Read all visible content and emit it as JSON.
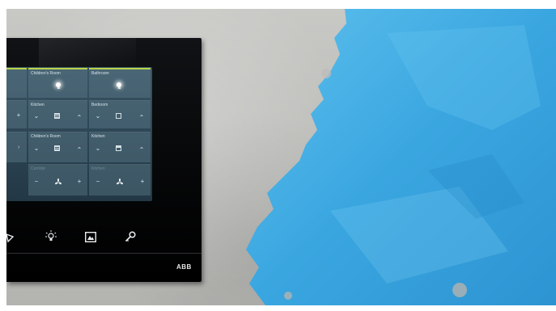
{
  "scene": {
    "colors": {
      "paint_blue": "#3aa6e0",
      "paint_blue_light": "#63c3ef",
      "wall_gray": "#bdbdba",
      "device_black": "#050607",
      "screen_teal": "#2c4453",
      "accent_green": "#b9d44a"
    }
  },
  "device": {
    "brand": "ABB",
    "tiles": [
      {
        "label": "Children's Room",
        "kind": "light",
        "active": true
      },
      {
        "label": "Bathroom",
        "kind": "light",
        "active": true
      },
      {
        "label": "Kitchen",
        "kind": "blind",
        "active": false
      },
      {
        "label": "Bedroom",
        "kind": "blind",
        "active": false
      },
      {
        "label": "Children's Room",
        "kind": "blind",
        "active": false
      },
      {
        "label": "Kitchen",
        "kind": "blind",
        "active": false
      },
      {
        "label": "Corridor",
        "kind": "fan",
        "active": false
      },
      {
        "label": "Kitchen",
        "kind": "fan",
        "active": false
      }
    ],
    "nav_buttons": [
      {
        "icon": "star-icon"
      },
      {
        "icon": "light-bulb-icon"
      },
      {
        "icon": "picture-frame-icon"
      },
      {
        "icon": "key-icon"
      }
    ]
  }
}
